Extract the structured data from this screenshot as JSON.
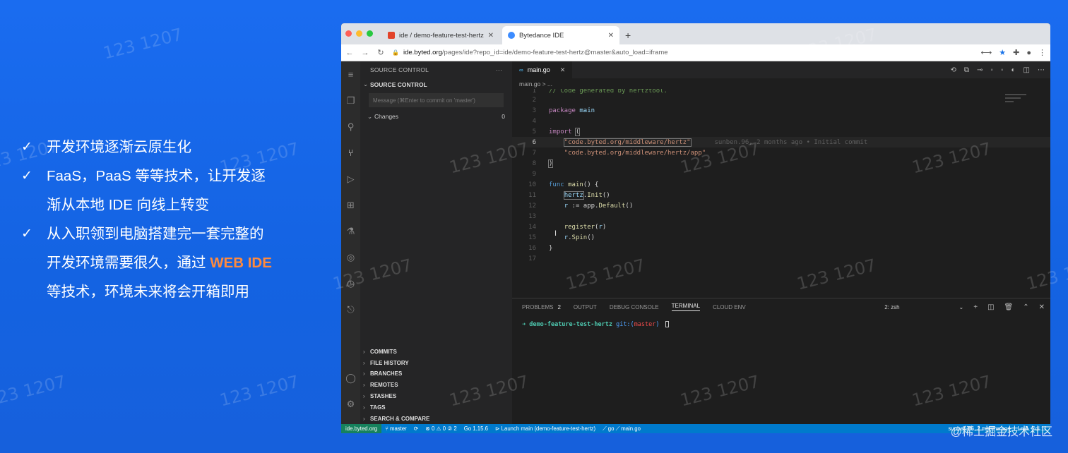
{
  "watermark": "123 1207",
  "slide": {
    "bullets": [
      {
        "check": "✓",
        "line1": "开发环境逐渐云原生化",
        "line2": ""
      },
      {
        "check": "✓",
        "line1": "FaaS，PaaS 等等技术，让开发逐",
        "line2": "渐从本地 IDE 向线上转变"
      },
      {
        "check": "✓",
        "line1": "从入职领到电脑搭建完一套完整的",
        "line2_pre": "开发环境需要很久，通过 ",
        "line2_accent": "WEB IDE",
        "line3": "等技术，环境未来将会开箱即用"
      }
    ],
    "accent_color": "#ff8a3d",
    "credit": "@稀土掘金技术社区"
  },
  "browser": {
    "tabs": [
      {
        "title": "ide / demo-feature-test-hertz",
        "close": "✕",
        "icon": "gitlab-icon",
        "active": false
      },
      {
        "title": "Bytedance IDE",
        "close": "✕",
        "icon": "bytedance-icon",
        "active": true
      }
    ],
    "new_tab": "+",
    "url_host": "ide.byted.org",
    "url_path": "/pages/ide?repo_id=ide/demo-feature-test-hertz@master&auto_load=iframe"
  },
  "ide": {
    "sidebar": {
      "title": "SOURCE CONTROL",
      "more": "···",
      "section": "SOURCE CONTROL",
      "message_placeholder": "Message (⌘Enter to commit on 'master')",
      "changes_label": "Changes",
      "changes_count": "0",
      "bottom_sections": [
        "COMMITS",
        "FILE HISTORY",
        "BRANCHES",
        "REMOTES",
        "STASHES",
        "TAGS",
        "SEARCH & COMPARE"
      ]
    },
    "editor": {
      "tab": "main.go",
      "tab_close": "✕",
      "breadcrumb": "main.go > ...",
      "blame": "sunben.96, 2 months ago • Initial commit"
    },
    "panel": {
      "tabs": [
        {
          "label": "PROBLEMS",
          "badge": "2"
        },
        {
          "label": "OUTPUT",
          "badge": ""
        },
        {
          "label": "DEBUG CONSOLE",
          "badge": ""
        },
        {
          "label": "TERMINAL",
          "badge": ""
        },
        {
          "label": "CLOUD ENV",
          "badge": ""
        }
      ],
      "terminal_select": "2: zsh",
      "terminal_dir": "demo-feature-test-hertz",
      "terminal_git_prefix": "git:(",
      "terminal_branch": "master",
      "terminal_git_suffix": ")"
    },
    "statusbar": {
      "remote": "ide.byted.org",
      "branch": "master",
      "sync": "⟳",
      "problems": "⊗ 0 ⚠ 0 ② 2",
      "go_version": "Go 1.15.6",
      "launch": "⊳ Launch main (demo-feature-test-hertz)",
      "path": "⟋ go ⟋ main.go",
      "blame": "sunben.96, 2 months ago",
      "position": "Ln 6, Col 11"
    }
  }
}
